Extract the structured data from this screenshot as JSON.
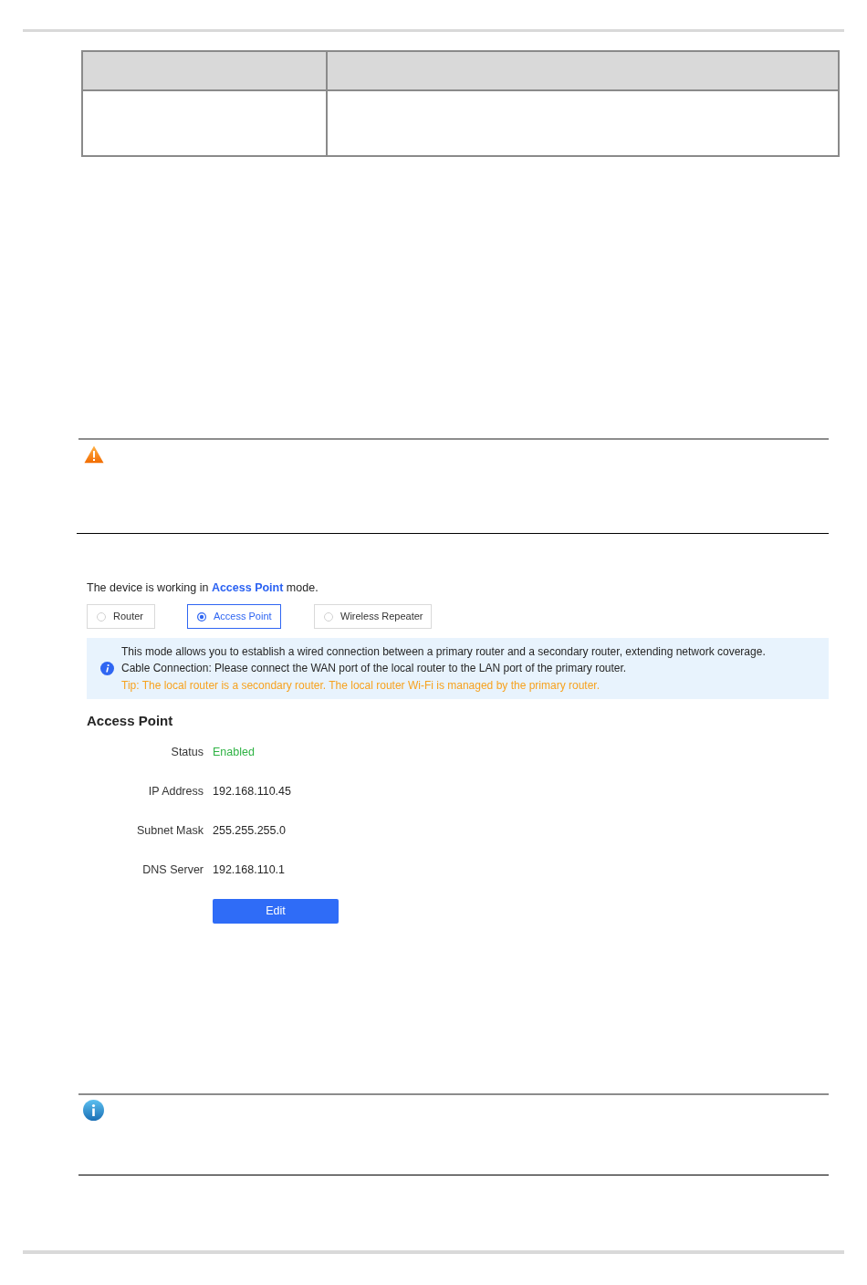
{
  "mode_status": {
    "text": "The device is working in **Access Point** mode."
  },
  "mode_options": [
    {
      "label": "Router",
      "selected": false
    },
    {
      "label": "Access Point",
      "selected": true
    },
    {
      "label": "Wireless Repeater",
      "selected": false
    }
  ],
  "alert": {
    "lines": [
      {
        "kind": "info",
        "text": "This mode allows you to establish a wired connection between a primary router and a secondary router, extending network coverage."
      },
      {
        "kind": "info",
        "text": "Cable Connection: Please connect the WAN port of the local router to the LAN port of the primary router."
      },
      {
        "kind": "tip",
        "text": "Tip: The local router is a secondary router. The local router Wi-Fi is managed by the primary router."
      }
    ]
  },
  "section": {
    "title": "Access Point",
    "fields": [
      {
        "label": "Status",
        "value": "Enabled",
        "kind": "status"
      },
      {
        "label": "IP Address",
        "value": "192.168.110.45",
        "kind": "text"
      },
      {
        "label": "Subnet Mask",
        "value": "255.255.255.0",
        "kind": "text"
      },
      {
        "label": "DNS Server",
        "value": "192.168.110.1",
        "kind": "text"
      }
    ]
  },
  "edit_button": {
    "label": "Edit"
  }
}
